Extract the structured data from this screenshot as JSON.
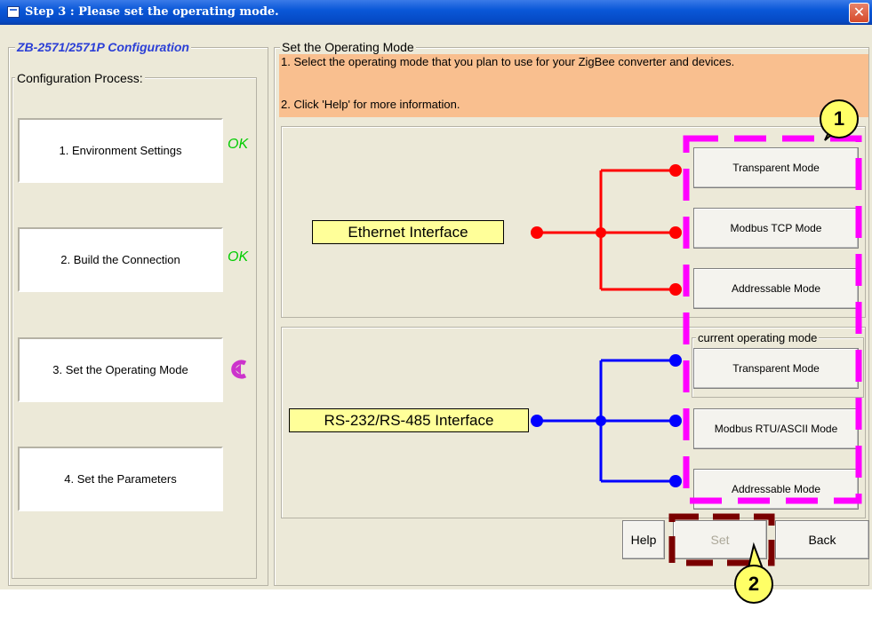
{
  "window": {
    "title": "Step 3 :  Please set the operating mode."
  },
  "sidebar": {
    "product_label": "ZB-2571/2571P Configuration",
    "process_label": "Configuration Process:",
    "steps": [
      {
        "label": "1. Environment Settings",
        "status": "OK"
      },
      {
        "label": "2. Build the Connection",
        "status": "OK"
      },
      {
        "label": "3. Set the Operating Mode",
        "status": ""
      },
      {
        "label": "4. Set the Parameters",
        "status": ""
      }
    ]
  },
  "main": {
    "group_label": "Set the Operating Mode",
    "instructions": [
      "1. Select the operating mode that you plan to use for your ZigBee converter and devices.",
      "2. Click 'Help' for more information."
    ],
    "ethernet": {
      "label": "Ethernet Interface",
      "modes": [
        "Transparent Mode",
        "Modbus TCP Mode",
        "Addressable Mode"
      ]
    },
    "serial": {
      "label": "RS-232/RS-485 Interface",
      "modes": [
        "Transparent Mode",
        "Modbus RTU/ASCII Mode",
        "Addressable Mode"
      ]
    },
    "current_mode_label": "current operating mode"
  },
  "buttons": {
    "help": "Help",
    "set": "Set",
    "back": "Back"
  },
  "callouts": {
    "one": "1",
    "two": "2"
  },
  "colors": {
    "ethernet_line": "#ff0000",
    "serial_line": "#0000ff",
    "highlight_dash": "#ff00ff",
    "set_dash": "#7a0000",
    "instruction_bg": "#f9bf8f",
    "ok_text": "#00cc00"
  },
  "icons": {
    "current_step": "back-arrow-icon",
    "window": "window-icon",
    "close": "close-icon"
  }
}
